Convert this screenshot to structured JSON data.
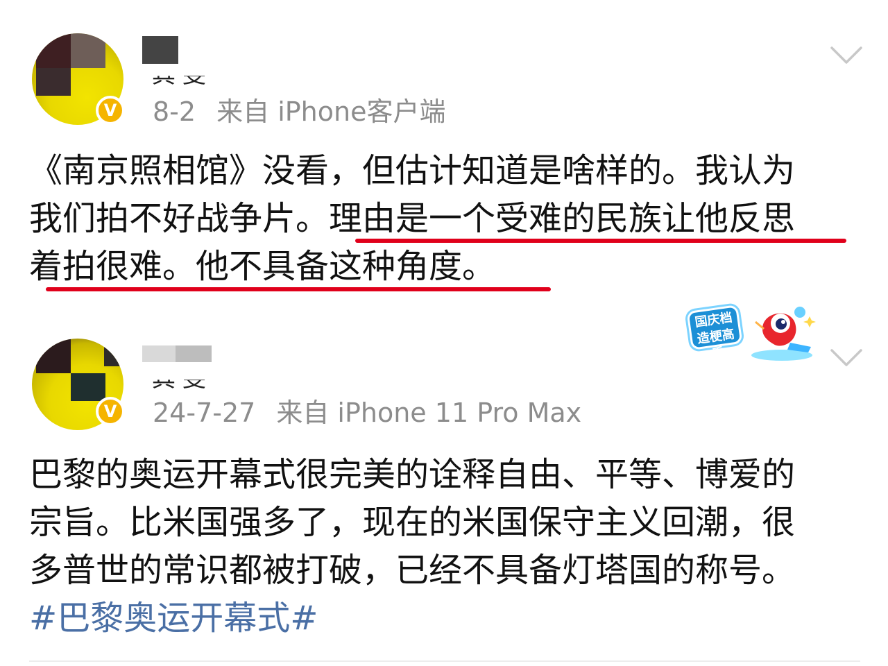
{
  "posts": [
    {
      "username_remnant": "其雯",
      "date": "8-2",
      "source_prefix": "来自",
      "source": "iPhone客户端",
      "lines": [
        "《南京照相馆》没看，但估计知道是啥样的。我认为",
        "我们拍不好战争片。理由是一个受难的民族让他反思",
        "着拍很难。他不具备这种角度。"
      ]
    },
    {
      "username_remnant": "其雯",
      "date": "24-7-27",
      "source_prefix": "来自",
      "source": "iPhone 11 Pro Max",
      "sticker_text": "国庆档造梗高手",
      "lines": [
        "巴黎的奥运开幕式很完美的诠释自由、平等、博爱的",
        "宗旨。比米国强多了，现在的米国保守主义回潮，很",
        "多普世的常识都被打破，已经不具备灯塔国的称号。"
      ],
      "hashtag": "#巴黎奥运开幕式#"
    }
  ],
  "colors": {
    "meta_gray": "#8c8c8c",
    "hashtag_blue": "#4a6fa5",
    "underline_red": "#e0001b",
    "verified_gold": "#f5b400"
  },
  "icons": {
    "expand": "chevron-down-icon",
    "verified": "verified-badge-icon"
  }
}
